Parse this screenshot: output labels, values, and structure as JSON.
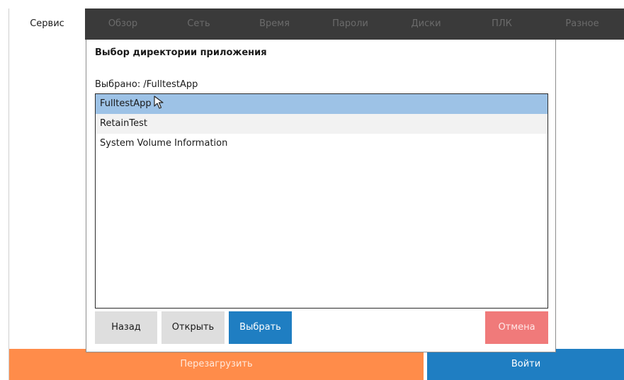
{
  "tabs": [
    {
      "label": "Сервис",
      "active": true
    },
    {
      "label": "Обзор",
      "active": false
    },
    {
      "label": "Сеть",
      "active": false
    },
    {
      "label": "Время",
      "active": false
    },
    {
      "label": "Пароли",
      "active": false
    },
    {
      "label": "Диски",
      "active": false
    },
    {
      "label": "ПЛК",
      "active": false
    },
    {
      "label": "Разное",
      "active": false
    }
  ],
  "dialog": {
    "title": "Выбор директории приложения",
    "selected_prefix": "Выбрано:",
    "selected_value": "/FulltestApp",
    "items": [
      {
        "name": "FulltestApp",
        "selected": true
      },
      {
        "name": "RetainTest",
        "selected": false
      },
      {
        "name": "System Volume Information",
        "selected": false
      }
    ],
    "buttons": {
      "back": "Назад",
      "open": "Открыть",
      "choose": "Выбрать",
      "cancel": "Отмена"
    }
  },
  "bottom": {
    "reboot": "Перезагрузить",
    "login": "Войти"
  },
  "colors": {
    "tabbar_bg": "#3a3a3a",
    "accent_blue": "#1f7ec2",
    "accent_orange": "#ff8c4a",
    "cancel_red": "#f07a7a",
    "selection": "#9dc2e6"
  },
  "icons": {
    "cursor": "mouse-pointer-icon"
  }
}
